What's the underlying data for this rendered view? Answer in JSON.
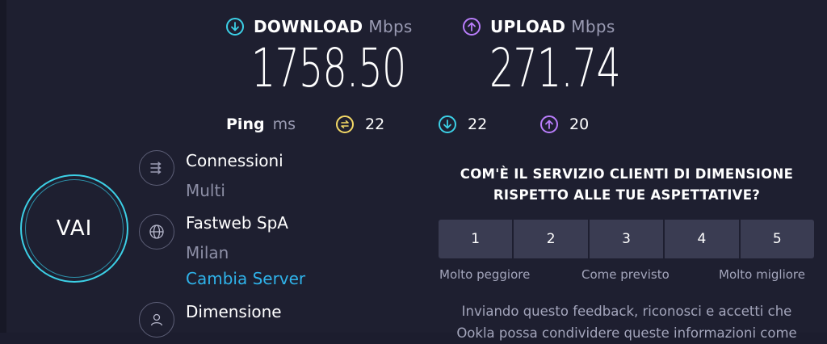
{
  "download": {
    "label": "DOWNLOAD",
    "unit": "Mbps",
    "value": "1758.50",
    "color": "#3cd0e6",
    "icon": "download-arrow-icon"
  },
  "upload": {
    "label": "UPLOAD",
    "unit": "Mbps",
    "value": "271.74",
    "color": "#b97dfb",
    "icon": "upload-arrow-icon"
  },
  "ping": {
    "label": "Ping",
    "unit": "ms",
    "idle": {
      "value": "22",
      "color": "#f3d866",
      "icon": "ping-jitter-icon"
    },
    "download": {
      "value": "22",
      "color": "#3cd0e6",
      "icon": "download-arrow-icon"
    },
    "upload": {
      "value": "20",
      "color": "#b97dfb",
      "icon": "upload-arrow-icon"
    }
  },
  "go_button": {
    "label": "VAI",
    "color": "#3cd0e6"
  },
  "info": {
    "connections": {
      "title": "Connessioni",
      "value": "Multi",
      "icon": "connections-icon"
    },
    "server": {
      "title": "Fastweb SpA",
      "location": "Milan",
      "change_link": "Cambia Server",
      "icon": "globe-icon"
    },
    "provider": {
      "title": "Dimensione",
      "icon": "user-icon"
    }
  },
  "survey": {
    "question_line1": "COM'È IL SERVIZIO CLIENTI DI DIMENSIONE",
    "question_line2": "RISPETTO ALLE TUE ASPETTATIVE?",
    "options": [
      "1",
      "2",
      "3",
      "4",
      "5"
    ],
    "label_low": "Molto peggiore",
    "label_mid": "Come previsto",
    "label_high": "Molto migliore",
    "disclaimer_line1": "Inviando questo feedback, riconosci e accetti che",
    "disclaimer_line2": "Ookla possa condividere queste informazioni come"
  }
}
